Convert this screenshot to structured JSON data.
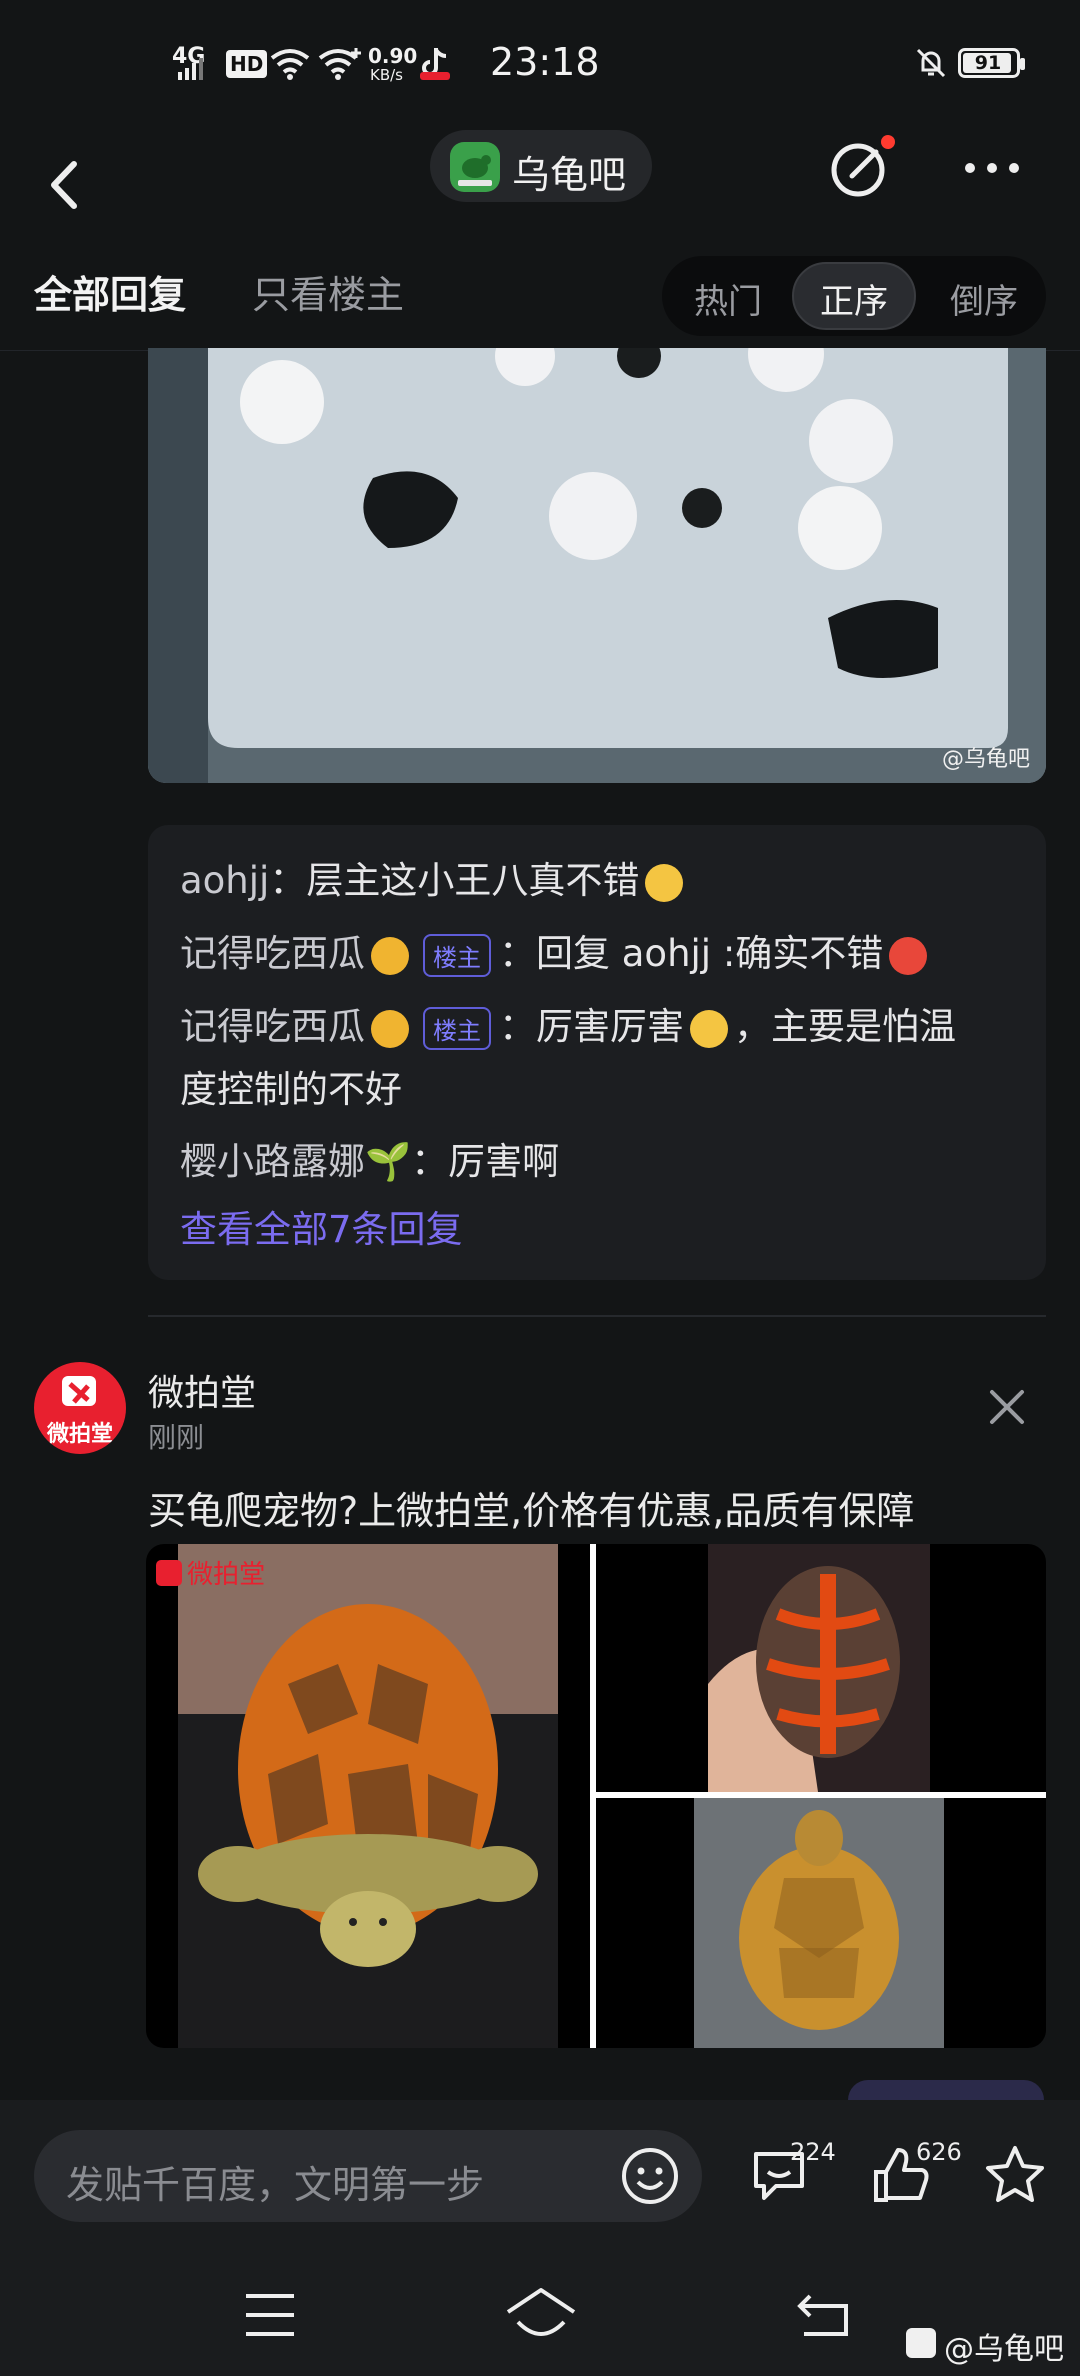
{
  "status_bar": {
    "network": "4G",
    "hd": "HD",
    "speed_value": "0.90",
    "speed_unit": "KB/s",
    "time": "23:18",
    "battery": "91"
  },
  "nav": {
    "forum_name": "乌龟吧"
  },
  "tabs": {
    "all_replies": "全部回复",
    "only_op": "只看楼主",
    "sort_hot": "热门",
    "sort_asc": "正序",
    "sort_desc": "倒序"
  },
  "post_image": {
    "watermark": "@乌龟吧"
  },
  "replies": [
    {
      "name": "aohjj",
      "sep": "：",
      "text": "层主这小王八真不错"
    },
    {
      "name": "记得吃西瓜",
      "tag": "楼主",
      "sep": "：",
      "text": "回复 aohjj :确实不错"
    },
    {
      "name": "记得吃西瓜",
      "tag": "楼主",
      "sep": "：",
      "text": "厉害厉害",
      "text_tail": "，主要是怕温",
      "text_line2": "度控制的不好"
    },
    {
      "name": "樱小路露娜",
      "sep": "：",
      "text": "厉害啊"
    }
  ],
  "view_all": "查看全部7条回复",
  "ad": {
    "avatar_text": "微拍堂",
    "name": "微拍堂",
    "time": "刚刚",
    "text": "买龟爬宠物?上微拍堂,价格有优惠,品质有保障",
    "image_logo": "微拍堂"
  },
  "bottom_bar": {
    "input_placeholder": "发贴千百度，文明第一步",
    "comment_count": "224",
    "like_count": "626"
  },
  "bottom_watermark": "@乌龟吧",
  "colors": {
    "background": "#131516",
    "accent_link": "#7b6cf0",
    "tag_border": "#5f5dd8",
    "brand_red": "#e8202f",
    "forum_green": "#3aa04a"
  }
}
